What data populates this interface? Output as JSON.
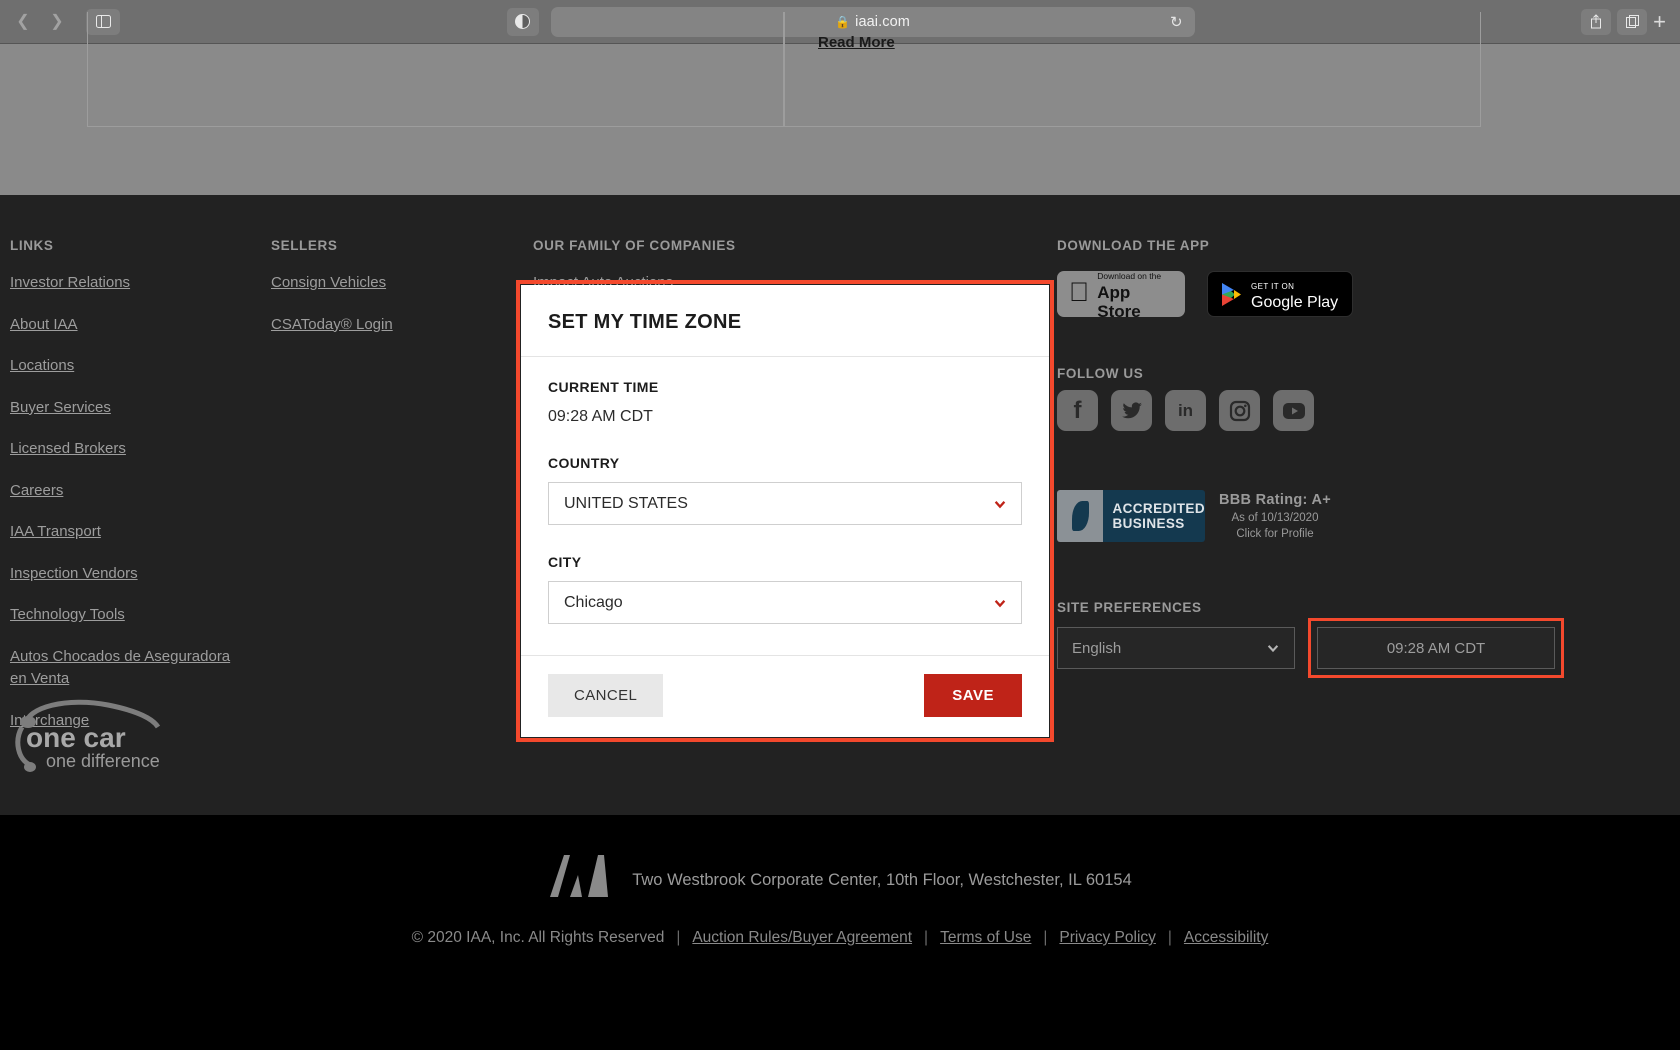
{
  "browser": {
    "url": "iaai.com",
    "lock_icon": "lock-icon",
    "back_icon": "chevron-left-icon",
    "forward_icon": "chevron-right-icon",
    "sidebar_icon": "sidebar-toggle-icon",
    "reader_icon": "reader-view-icon",
    "reload_icon": "reload-icon",
    "share_icon": "share-icon",
    "tabs_icon": "new-tab-overview-icon",
    "plus_icon": "plus-icon"
  },
  "page_top": {
    "read_more": "Read More"
  },
  "footer": {
    "links": {
      "title": "LINKS",
      "items": [
        "Investor Relations",
        "About IAA",
        "Locations",
        "Buyer Services",
        "Licensed Brokers",
        "Careers",
        "IAA Transport",
        "Inspection Vendors",
        "Technology Tools",
        "Autos Chocados de Aseguradora en Venta",
        "Interchange"
      ]
    },
    "sellers": {
      "title": "SELLERS",
      "items": [
        "Consign Vehicles",
        "CSAToday® Login"
      ]
    },
    "family": {
      "title": "OUR FAMILY OF COMPANIES",
      "items": [
        "Impact Auto Auctions"
      ]
    },
    "app": {
      "title": "DOWNLOAD THE APP",
      "apple": {
        "small": "Download on the",
        "large": "App Store",
        "icon": "apple-logo-icon"
      },
      "google": {
        "small": "GET IT ON",
        "large": "Google Play",
        "icon": "google-play-icon"
      }
    },
    "follow": {
      "title": "FOLLOW US",
      "items": [
        {
          "name": "facebook-icon",
          "glyph": "f"
        },
        {
          "name": "twitter-icon",
          "glyph": "t"
        },
        {
          "name": "linkedin-icon",
          "glyph": "in"
        },
        {
          "name": "instagram-icon",
          "glyph": "◎"
        },
        {
          "name": "youtube-icon",
          "glyph": "▶"
        }
      ]
    },
    "bbb": {
      "badge_line1": "ACCREDITED",
      "badge_line2": "BUSINESS",
      "brand": "BBB",
      "rating": "BBB Rating: A+",
      "as_of": "As of 10/13/2020",
      "profile": "Click for Profile"
    },
    "site_preferences": {
      "title": "SITE PREFERENCES",
      "language": "English",
      "language_chevron": "chevron-down-icon",
      "timezone_button": "09:28 AM CDT"
    },
    "onecar": {
      "line1": "one car",
      "line2": "one difference"
    }
  },
  "bottom": {
    "logo": "IAA",
    "address": "Two Westbrook Corporate Center, 10th Floor, Westchester, IL 60154",
    "copyright": "© 2020 IAA, Inc. All Rights Reserved",
    "separator": "|",
    "legal_links": [
      "Auction Rules/Buyer Agreement",
      "Terms of Use",
      "Privacy Policy",
      "Accessibility"
    ]
  },
  "modal": {
    "title": "SET MY TIME ZONE",
    "current_time_label": "CURRENT TIME",
    "current_time_value": "09:28 AM CDT",
    "country_label": "COUNTRY",
    "country_value": "UNITED STATES",
    "city_label": "CITY",
    "city_value": "Chicago",
    "cancel_label": "CANCEL",
    "save_label": "SAVE",
    "chevron_icon": "chevron-down-icon"
  },
  "colors": {
    "accent_red": "#bf2318",
    "highlight": "#f4492d",
    "footer_bg": "#222222",
    "bottom_bg": "#000000"
  }
}
